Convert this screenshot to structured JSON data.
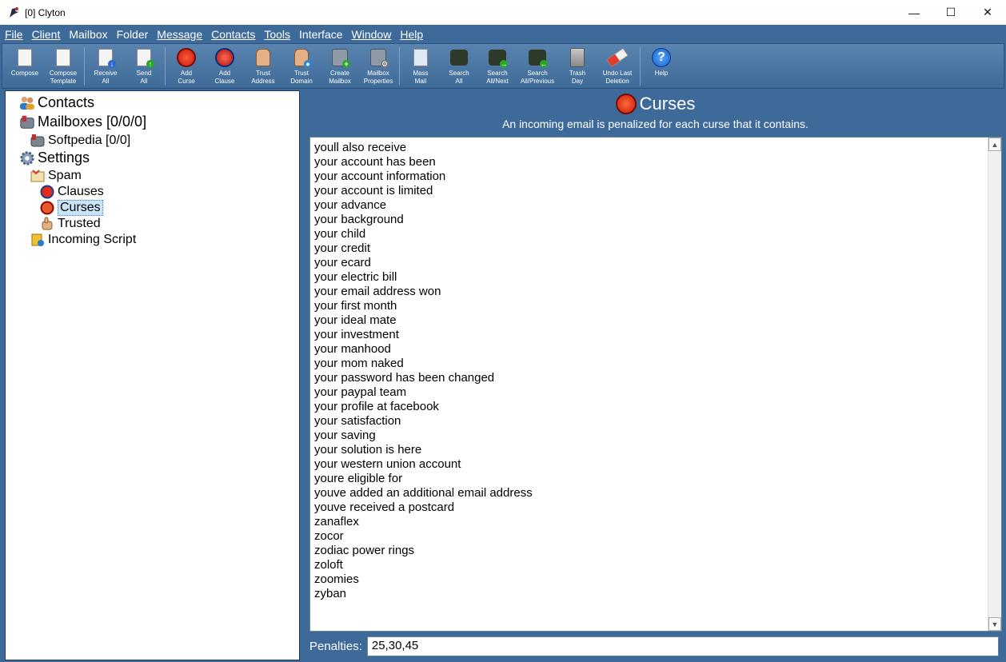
{
  "window": {
    "title": "[0] Clyton",
    "minimize": "—",
    "maximize": "☐",
    "close": "✕"
  },
  "menu": [
    "File",
    "Client",
    "Mailbox",
    "Folder",
    "Message",
    "Contacts",
    "Tools",
    "Interface",
    "Window",
    "Help"
  ],
  "toolbar": [
    {
      "label": "Compose",
      "icon": "compose-icon"
    },
    {
      "label": "Compose\nTemplate",
      "icon": "compose-template-icon"
    },
    {
      "label": "Receive\nAll",
      "icon": "receive-all-icon"
    },
    {
      "label": "Send\nAll",
      "icon": "send-all-icon"
    },
    {
      "label": "Add\nCurse",
      "icon": "add-curse-icon"
    },
    {
      "label": "Add\nClause",
      "icon": "add-clause-icon"
    },
    {
      "label": "Trust\nAddress",
      "icon": "trust-address-icon"
    },
    {
      "label": "Trust\nDomain",
      "icon": "trust-domain-icon"
    },
    {
      "label": "Create\nMailbox",
      "icon": "create-mailbox-icon"
    },
    {
      "label": "Mailbox\nProperties",
      "icon": "mailbox-properties-icon"
    },
    {
      "label": "Mass\nMail",
      "icon": "mass-mail-icon"
    },
    {
      "label": "Search\nAll",
      "icon": "search-all-icon"
    },
    {
      "label": "Search\nAll/Next",
      "icon": "search-next-icon"
    },
    {
      "label": "Search\nAll/Previous",
      "icon": "search-previous-icon"
    },
    {
      "label": "Trash\nDay",
      "icon": "trash-icon"
    },
    {
      "label": "Undo Last\nDeletion",
      "icon": "eraser-icon"
    },
    {
      "label": "Help",
      "icon": "help-icon"
    }
  ],
  "tree": {
    "contacts": "Contacts",
    "mailboxes": "Mailboxes [0/0/0]",
    "softpedia": "Softpedia [0/0]",
    "settings": "Settings",
    "spam": "Spam",
    "clauses": "Clauses",
    "curses": "Curses",
    "trusted": "Trusted",
    "incoming_script": "Incoming Script"
  },
  "panel": {
    "title": "Curses",
    "subtitle": "An incoming email is penalized for each curse that it contains.",
    "penalties_label": "Penalties:",
    "penalties_value": "25,30,45"
  },
  "curses": [
    "youll also receive",
    "your account has been",
    "your account information",
    "your account is limited",
    "your advance",
    "your background",
    "your child",
    "your credit",
    "your ecard",
    "your electric bill",
    "your email address won",
    "your first month",
    "your ideal mate",
    "your investment",
    "your manhood",
    "your mom naked",
    "your password has been changed",
    "your paypal team",
    "your profile at facebook",
    "your satisfaction",
    "your saving",
    "your solution is here",
    "your western union account",
    "youre eligible for",
    "youve added an additional email address",
    "youve received a postcard",
    "zanaflex",
    "zocor",
    "zodiac power rings",
    "zoloft",
    "zoomies",
    "zyban"
  ]
}
